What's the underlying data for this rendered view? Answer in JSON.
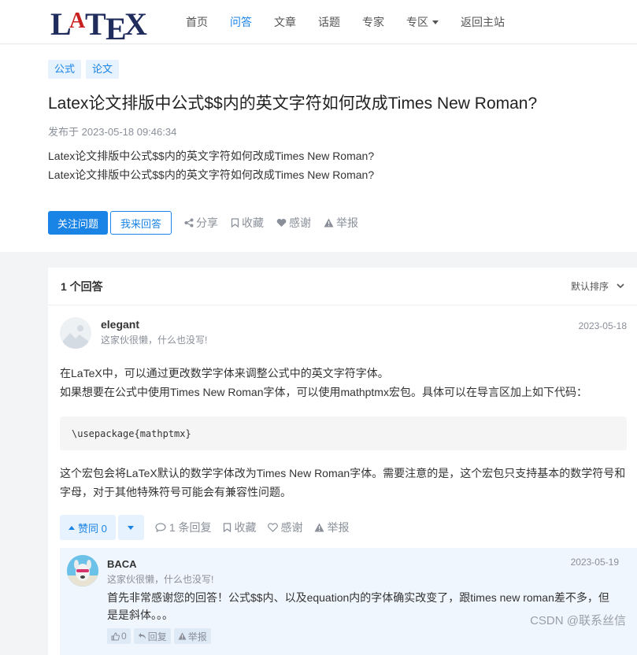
{
  "header": {
    "nav": [
      {
        "label": "首页"
      },
      {
        "label": "问答",
        "active": true
      },
      {
        "label": "文章"
      },
      {
        "label": "话题"
      },
      {
        "label": "专家"
      },
      {
        "label": "专区",
        "dropdown": true
      },
      {
        "label": "返回主站"
      }
    ]
  },
  "question": {
    "tags": [
      "公式",
      "论文"
    ],
    "title": "Latex论文排版中公式$$内的英文字符如何改成Times New Roman?",
    "meta": "发布于 2023-05-18 09:46:34",
    "body_lines": [
      "Latex论文排版中公式$$内的英文字符如何改成Times New Roman?",
      "Latex论文排版中公式$$内的英文字符如何改成Times New Roman?"
    ],
    "follow_label": "关注问题",
    "answer_label": "我来回答",
    "share_label": "分享",
    "favorite_label": "收藏",
    "thanks_label": "感谢",
    "report_label": "举报"
  },
  "answers": {
    "count_label": "1 个回答",
    "sort_label": "默认排序",
    "answer": {
      "user": "elegant",
      "signature": "这家伙很懒，什么也没写!",
      "date": "2023-05-18",
      "text_lines": [
        "在LaTeX中，可以通过更改数学字体来调整公式中的英文字符字体。",
        "如果想要在公式中使用Times New Roman字体，可以使用mathptmx宏包。具体可以在导言区加上如下代码："
      ],
      "code": "\\usepackage{mathptmx}",
      "text2": "这个宏包会将LaTeX默认的数学字体改为Times New Roman字体。需要注意的是，这个宏包只支持基本的数学符号和字母，对于其他特殊符号可能会有兼容性问题。",
      "upvote_label": "赞同 0",
      "reply_label": "1 条回复",
      "favorite_label": "收藏",
      "thanks_label": "感谢",
      "report_label": "举报"
    },
    "comment": {
      "user": "BACA",
      "signature": "这家伙很懒，什么也没写!",
      "date": "2023-05-19",
      "text": "首先非常感谢您的回答！公式$$内、以及equation内的字体确实改变了，跟times new roman差不多，但是是斜体。。。",
      "like_label": "0",
      "reply_label": "回复",
      "report_label": "举报"
    }
  },
  "watermark": "CSDN @联系丝信",
  "colors": {
    "accent": "#1a83e6",
    "muted": "#8a8f99",
    "tag_bg": "#e6f2fd",
    "comment_bg": "#f0f6fd"
  }
}
